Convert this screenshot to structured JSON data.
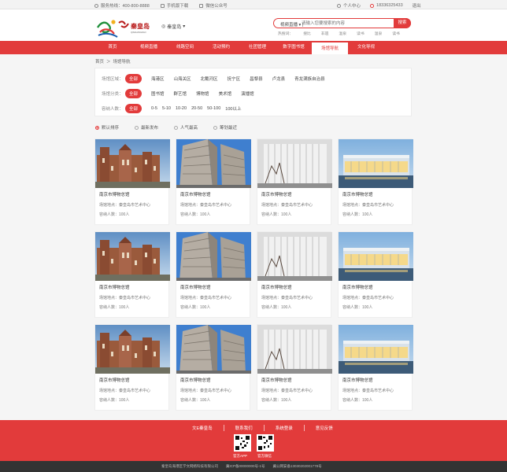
{
  "topbar": {
    "hotline": "服务热线：400-800-8888",
    "app": "手机版下载",
    "wechat": "微信公众号",
    "user_center": "个人中心",
    "phone": "18336325433",
    "logout": "退出"
  },
  "header": {
    "city": "秦皇岛",
    "search_type": "视频直播",
    "search_placeholder": "请输入您要搜索的内容",
    "search_button": "搜索",
    "hot_words": [
      "热搜词：",
      "搜比",
      "非遗",
      "温泉",
      "读书",
      "温泉",
      "读书"
    ]
  },
  "nav": {
    "items": [
      "首页",
      "视频直播",
      "线路空间",
      "活动预约",
      "社团管理",
      "数字图书馆",
      "场馆导航",
      "文化导视"
    ],
    "active_index": 6
  },
  "breadcrumb": [
    "首页",
    "＞",
    "场馆导航"
  ],
  "filters": {
    "rows": [
      {
        "label": "场馆区域：",
        "selected": "全部",
        "options": [
          "海港区",
          "山海关区",
          "北戴河区",
          "抚宁区",
          "昌黎县",
          "卢龙县",
          "青龙满族自治县"
        ]
      },
      {
        "label": "场馆分类：",
        "selected": "全部",
        "options": [
          "图书馆",
          "群艺馆",
          "博物馆",
          "美术馆",
          "演播馆"
        ]
      },
      {
        "label": "容纳人数：",
        "selected": "全部",
        "options": [
          "0-5",
          "5-10",
          "10-20",
          "20-50",
          "50-100",
          "100以上"
        ]
      }
    ]
  },
  "sort": {
    "options": [
      "默认排序",
      "最新发布",
      "人气最高",
      "筹划最近"
    ],
    "selected_index": 0
  },
  "cards": [
    {
      "title": "南京市博物总馆",
      "address": "场馆地点：秦皇岛市艺术中心",
      "capacity": "容纳人数：100人",
      "pic": "church"
    },
    {
      "title": "南京市博物总馆",
      "address": "场馆地点：秦皇岛市艺术中心",
      "capacity": "容纳人数：100人",
      "pic": "concrete"
    },
    {
      "title": "南京市博物总馆",
      "address": "场馆地点：秦皇岛市艺术中心",
      "capacity": "容纳人数：100人",
      "pic": "white"
    },
    {
      "title": "南京市博物总馆",
      "address": "场馆地点：秦皇岛市艺术中心",
      "capacity": "容纳人数：100人",
      "pic": "night"
    },
    {
      "title": "南京市博物总馆",
      "address": "场馆地点：秦皇岛市艺术中心",
      "capacity": "容纳人数：100人",
      "pic": "church"
    },
    {
      "title": "南京市博物总馆",
      "address": "场馆地点：秦皇岛市艺术中心",
      "capacity": "容纳人数：100人",
      "pic": "concrete"
    },
    {
      "title": "南京市博物总馆",
      "address": "场馆地点：秦皇岛市艺术中心",
      "capacity": "容纳人数：100人",
      "pic": "white"
    },
    {
      "title": "南京市博物总馆",
      "address": "场馆地点：秦皇岛市艺术中心",
      "capacity": "容纳人数：100人",
      "pic": "night"
    },
    {
      "title": "南京市博物总馆",
      "address": "场馆地点：秦皇岛市艺术中心",
      "capacity": "容纳人数：100人",
      "pic": "church"
    },
    {
      "title": "南京市博物总馆",
      "address": "场馆地点：秦皇岛市艺术中心",
      "capacity": "容纳人数：100人",
      "pic": "concrete"
    },
    {
      "title": "南京市博物总馆",
      "address": "场馆地点：秦皇岛市艺术中心",
      "capacity": "容纳人数：100人",
      "pic": "white"
    },
    {
      "title": "南京市博物总馆",
      "address": "场馆地点：秦皇岛市艺术中心",
      "capacity": "容纳人数：100人",
      "pic": "night"
    }
  ],
  "footer": {
    "links": [
      "文E秦皇岛",
      "联系我们",
      "系统登录",
      "意见反馈"
    ],
    "qr_labels": [
      "官方APP",
      "官方微信"
    ],
    "copyright": [
      "秦皇岛海港区学文网络科技有限公司",
      "冀ICP备00000000号-1号",
      "冀公网安备13030202001778号"
    ]
  },
  "colors": {
    "brand": "#e23b3b"
  }
}
